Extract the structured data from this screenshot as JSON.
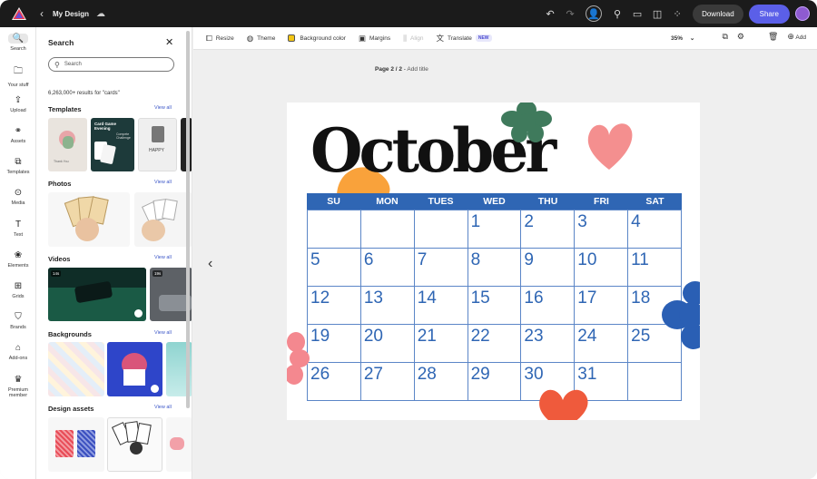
{
  "topbar": {
    "back_label": "‹",
    "doc_title": "My Design",
    "download_label": "Download",
    "share_label": "Share"
  },
  "rail": [
    {
      "label": "Search",
      "icon": "search-icon",
      "glyph": "🔍"
    },
    {
      "label": "Your stuff",
      "icon": "folder-icon",
      "glyph": "🗀"
    },
    {
      "label": "Upload",
      "icon": "upload-icon",
      "glyph": "⇪"
    },
    {
      "label": "Assets",
      "icon": "shapes-icon",
      "glyph": "⚭"
    },
    {
      "label": "Templates",
      "icon": "templates-icon",
      "glyph": "⧉"
    },
    {
      "label": "Media",
      "icon": "media-icon",
      "glyph": "⊙"
    },
    {
      "label": "Text",
      "icon": "text-icon",
      "glyph": "T"
    },
    {
      "label": "Elements",
      "icon": "elements-icon",
      "glyph": "❀"
    },
    {
      "label": "Grids",
      "icon": "grid-icon",
      "glyph": "⊞"
    },
    {
      "label": "Brands",
      "icon": "brand-icon",
      "glyph": "⛉"
    },
    {
      "label": "Add-ons",
      "icon": "addons-icon",
      "glyph": "⌂"
    },
    {
      "label": "Premium member",
      "icon": "crown-icon",
      "glyph": "♛"
    }
  ],
  "panel": {
    "title": "Search",
    "search_placeholder": "Search",
    "results_text": "6,263,000+ results for \"cards\"",
    "view_all": "View all",
    "sections": [
      "Templates",
      "Photos",
      "Videos",
      "Backgrounds",
      "Design assets"
    ],
    "video_badges": [
      "14s",
      "19s"
    ],
    "template_texts": [
      "Thank You",
      "Card Game Evening",
      "Compete Challenge",
      "HAPPY"
    ]
  },
  "toolbar": {
    "resize": "Resize",
    "theme": "Theme",
    "background_color": "Background color",
    "margins": "Margins",
    "align": "Align",
    "translate": "Translate",
    "new_badge": "NEW",
    "zoom": "35%",
    "add": "Add"
  },
  "canvas": {
    "page_number": "Page 2 / 2",
    "add_title": "Add title"
  },
  "calendar": {
    "month": "October",
    "weekdays": [
      "SU",
      "MON",
      "TUES",
      "WED",
      "THU",
      "FRI",
      "SAT"
    ],
    "days": [
      "",
      "",
      "",
      "1",
      "2",
      "3",
      "4",
      "5",
      "6",
      "7",
      "8",
      "9",
      "10",
      "11",
      "12",
      "13",
      "14",
      "15",
      "16",
      "17",
      "18",
      "19",
      "20",
      "21",
      "22",
      "23",
      "24",
      "25",
      "26",
      "27",
      "28",
      "29",
      "30",
      "31",
      ""
    ]
  },
  "colors": {
    "accent": "#5b5fe8",
    "calendar_blue": "#2f66b4",
    "heart_pink": "#f48f8f",
    "flower_green": "#3f7a5c",
    "blob_orange": "#f9a23b",
    "heart_red": "#ef5a3c"
  }
}
